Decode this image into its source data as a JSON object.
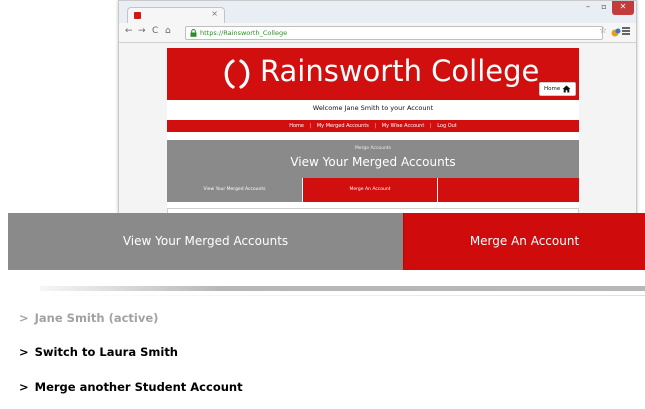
{
  "browser": {
    "tab_close": "×",
    "url": "https://Rainsworth_College",
    "controls": {
      "minimize": "–",
      "restore": "▫",
      "close": "✕"
    },
    "nav": {
      "back": "←",
      "forward": "→",
      "reload": "C",
      "home": "⌂"
    },
    "star": "☆"
  },
  "site": {
    "title": "Rainsworth College",
    "home_button": "Home",
    "welcome": "Welcome Jane Smith to your Account",
    "nav": [
      "Home",
      "My Merged Accounts",
      "My Wise Account",
      "Log Out"
    ],
    "nav_separator": "|",
    "breadcrumb": "Merge Accounts",
    "panel_title": "View Your Merged Accounts",
    "subtabs": [
      "View Your Merged Accounts",
      "Merge An Account",
      ""
    ]
  },
  "zoom": {
    "tabs": {
      "view": "View Your Merged Accounts",
      "merge": "Merge An Account"
    },
    "accounts": [
      {
        "chevron": ">",
        "label": "Jane Smith (active)"
      },
      {
        "chevron": ">",
        "label": "Switch to Laura Smith"
      },
      {
        "chevron": ">",
        "label": "Merge another Student Account"
      }
    ]
  },
  "colors": {
    "brand_red": "#d10f0f",
    "panel_grey": "#8a8a8a",
    "active_text": "#a2a2a2"
  },
  "icons": [
    "favicon-icon",
    "close-icon",
    "lock-icon",
    "extension-icon",
    "star-icon",
    "menu-icon",
    "laurel-logo-icon",
    "home-icon"
  ]
}
